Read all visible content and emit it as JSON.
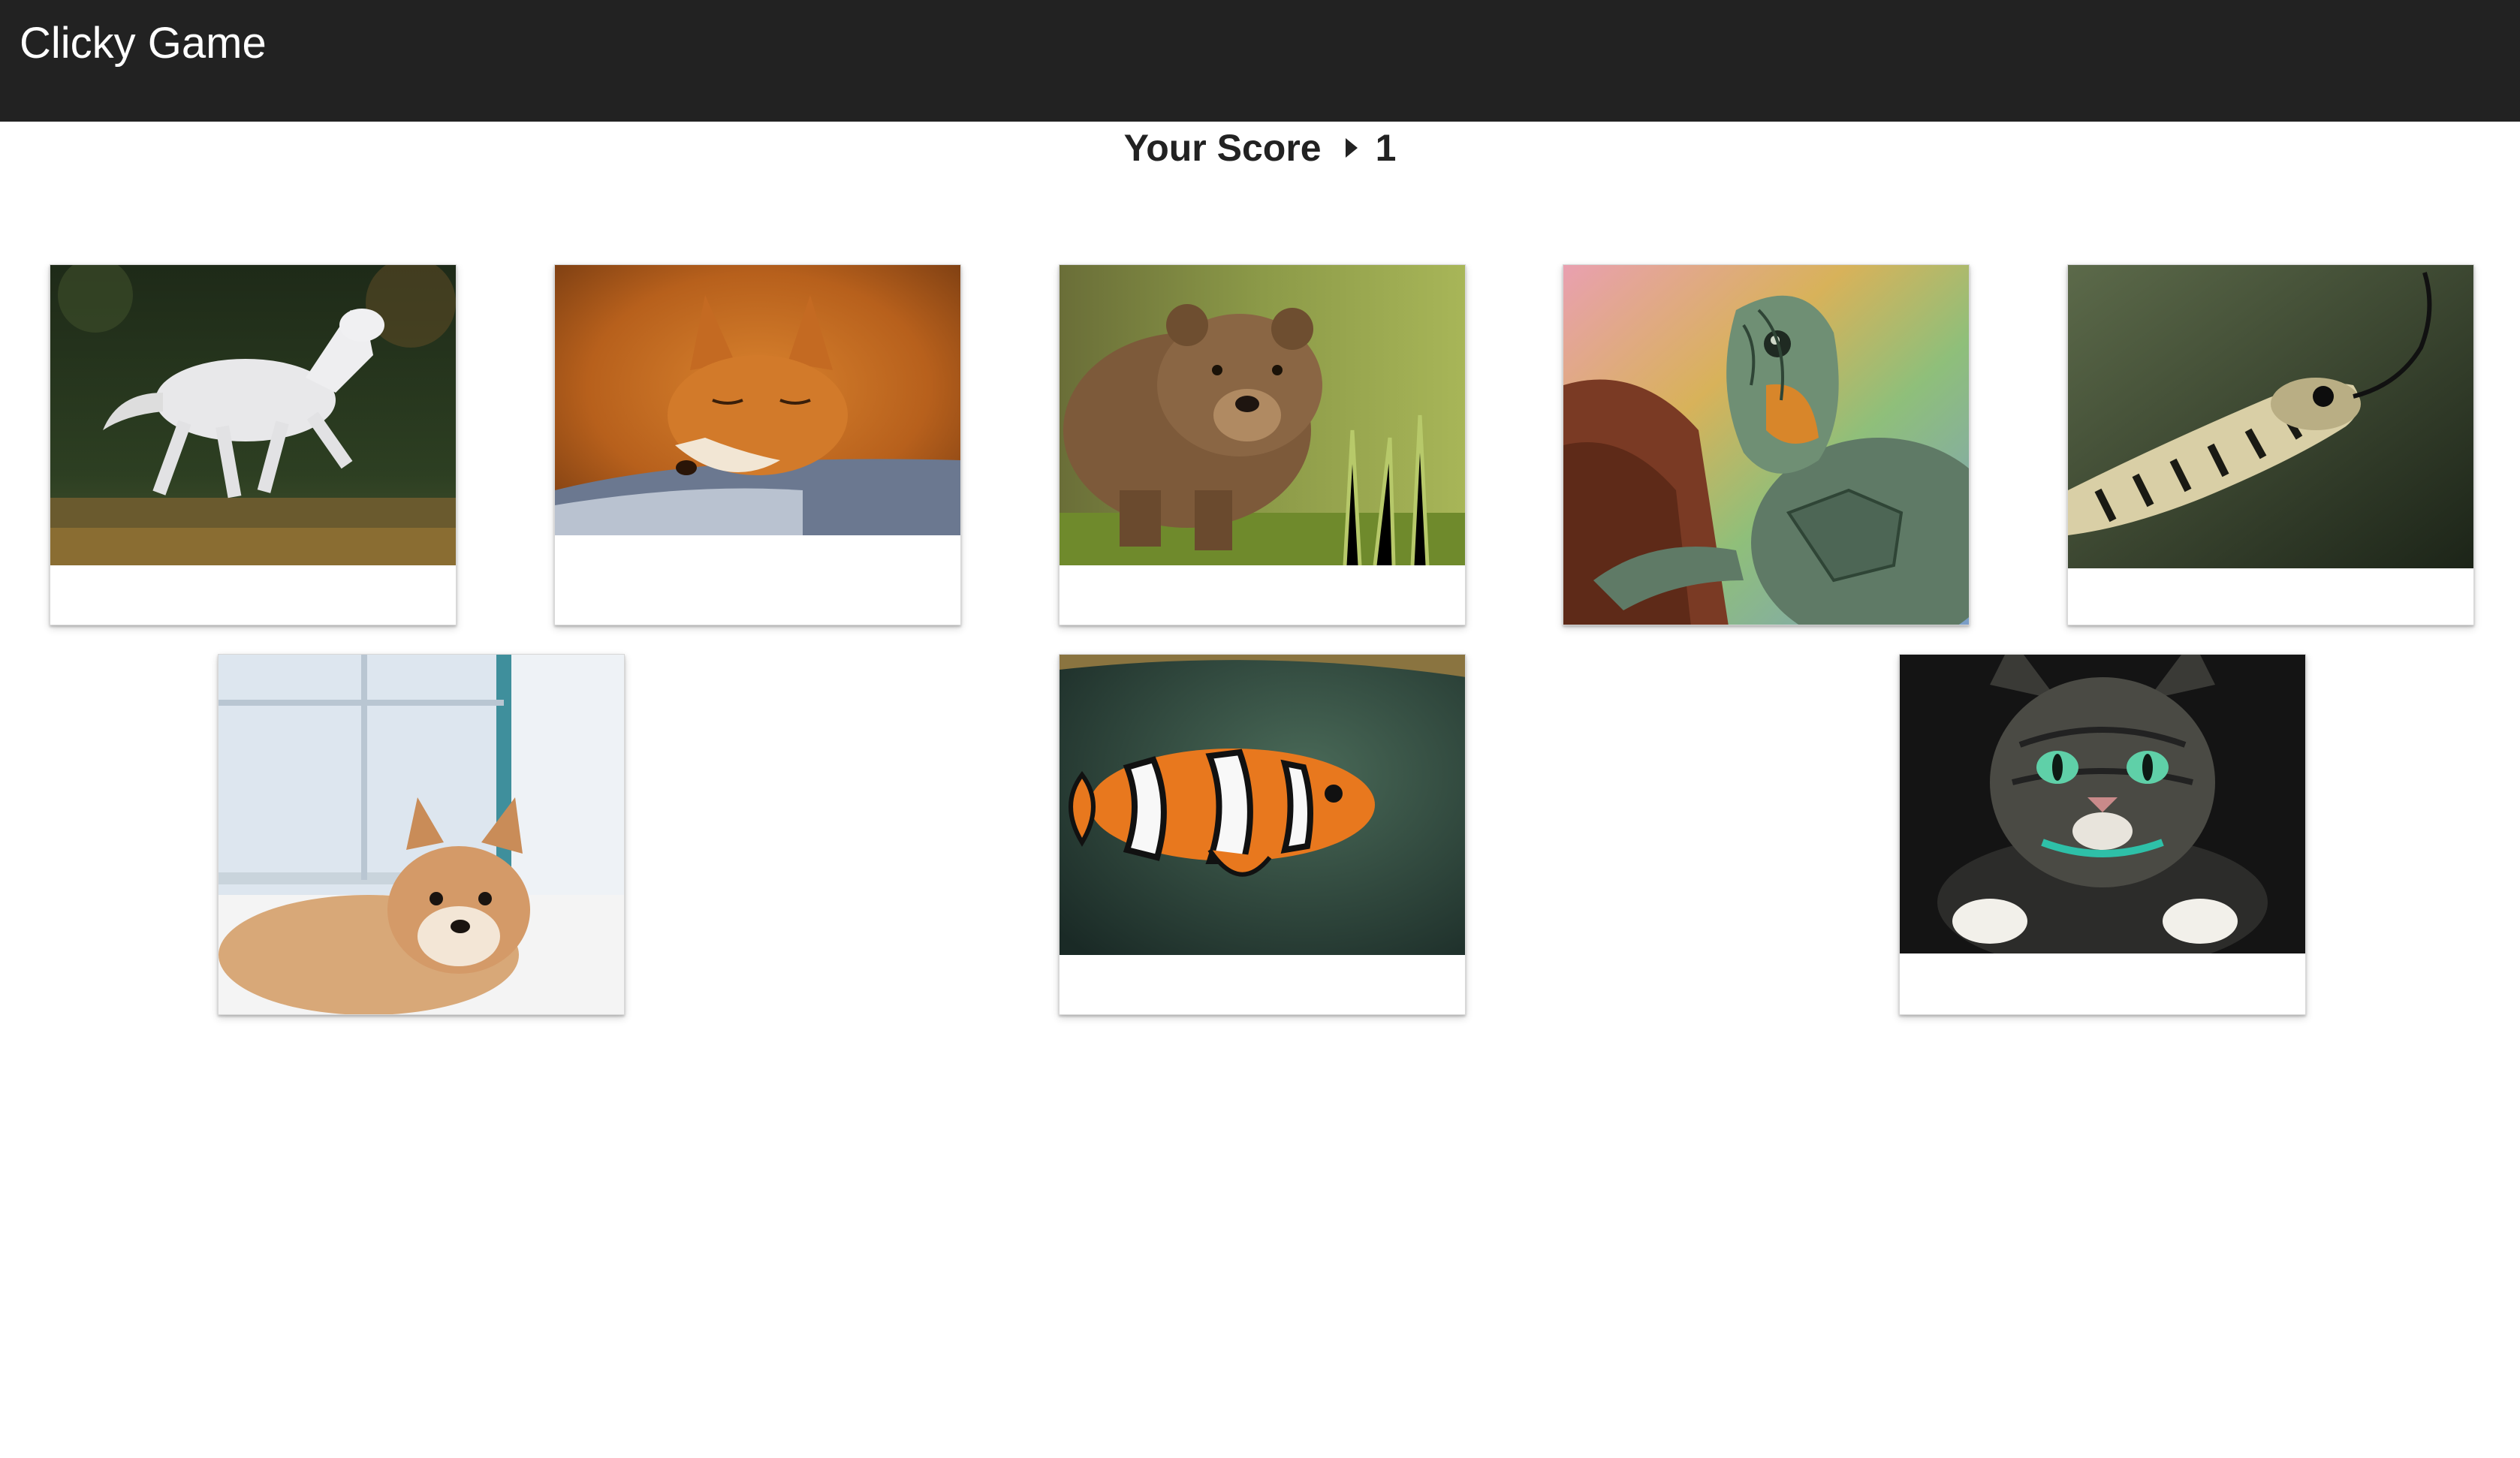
{
  "navbar": {
    "brand": "Clicky Game"
  },
  "score": {
    "label": "Your Score",
    "value": "1"
  },
  "cards": [
    {
      "animal": "horse"
    },
    {
      "animal": "fox"
    },
    {
      "animal": "bear"
    },
    {
      "animal": "turtle"
    },
    {
      "animal": "snake"
    },
    {
      "animal": "dog"
    },
    {
      "animal": "clownfish"
    },
    {
      "animal": "cat"
    }
  ],
  "colors": {
    "navbar": "#222222",
    "background": "#ffffff",
    "score_text": "#222222"
  }
}
